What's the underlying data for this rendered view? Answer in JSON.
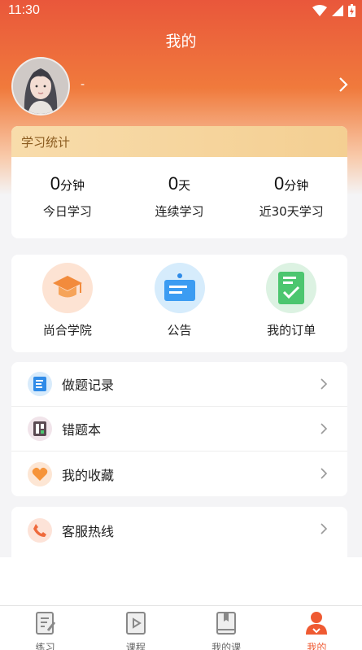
{
  "status_bar": {
    "time": "11:30"
  },
  "header": {
    "title": "我的"
  },
  "profile": {
    "username": "-"
  },
  "stats": {
    "title": "学习统计",
    "items": [
      {
        "value": "0",
        "unit": "分钟",
        "label": "今日学习"
      },
      {
        "value": "0",
        "unit": "天",
        "label": "连续学习"
      },
      {
        "value": "0",
        "unit": "分钟",
        "label": "近30天学习"
      }
    ]
  },
  "quick_links": [
    {
      "label": "尚合学院",
      "icon": "graduation-cap-icon"
    },
    {
      "label": "公告",
      "icon": "notice-board-icon"
    },
    {
      "label": "我的订单",
      "icon": "order-check-icon"
    }
  ],
  "menu_group1": [
    {
      "label": "做题记录",
      "icon": "exercise-record-icon"
    },
    {
      "label": "错题本",
      "icon": "mistake-book-icon"
    },
    {
      "label": "我的收藏",
      "icon": "heart-icon"
    }
  ],
  "menu_group2": [
    {
      "label": "客服热线",
      "icon": "phone-icon"
    }
  ],
  "bottom_nav": [
    {
      "label": "练习",
      "icon": "practice-icon"
    },
    {
      "label": "课程",
      "icon": "video-icon"
    },
    {
      "label": "我的课",
      "icon": "book-icon"
    },
    {
      "label": "我的",
      "icon": "user-icon",
      "active": true
    }
  ],
  "colors": {
    "accent": "#ef5a32",
    "header_top": "#e9573b",
    "stats_head": "#f8dcab"
  }
}
